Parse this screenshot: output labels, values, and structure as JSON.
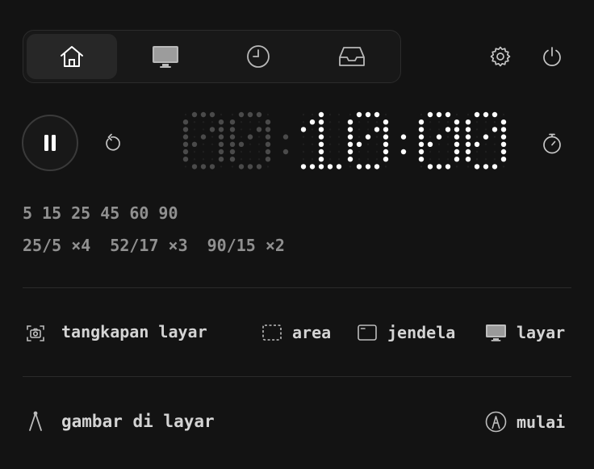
{
  "tabs": [
    {
      "name": "home",
      "icon": "home-icon",
      "active": true
    },
    {
      "name": "display",
      "icon": "monitor-icon",
      "active": false
    },
    {
      "name": "history",
      "icon": "clock-icon",
      "active": false
    },
    {
      "name": "inbox",
      "icon": "inbox-icon",
      "active": false
    }
  ],
  "timer": {
    "display": "00:10:00",
    "dim_part": "00:",
    "bright_part": "10:00",
    "state": "running"
  },
  "presets_minutes": [
    "5",
    "15",
    "25",
    "45",
    "60",
    "90"
  ],
  "presets_intervals": [
    "25/5 ×4",
    "52/17 ×3",
    "90/15 ×2"
  ],
  "screenshot": {
    "label": "tangkapan layar",
    "actions": [
      {
        "label": "area",
        "icon": "dashed-rect-icon"
      },
      {
        "label": "jendela",
        "icon": "window-icon"
      },
      {
        "label": "layar",
        "icon": "monitor-icon"
      }
    ]
  },
  "draw": {
    "label": "gambar di layar",
    "start_label": "mulai"
  },
  "colors": {
    "background": "#131313",
    "dot_bright": "#ffffff",
    "dot_dim": "#4a4a4a"
  }
}
